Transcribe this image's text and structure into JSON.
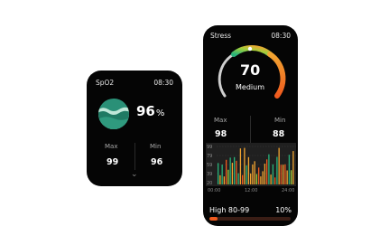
{
  "spo2": {
    "title": "SpO2",
    "time": "08:30",
    "value": "96",
    "unit": "%",
    "max_label": "Max",
    "max_value": "99",
    "min_label": "Min",
    "min_value": "96",
    "chevron": "⌄"
  },
  "stress": {
    "title": "Stress",
    "time": "08:30",
    "value": "70",
    "level": "Medium",
    "max_label": "Max",
    "max_value": "98",
    "min_label": "Min",
    "min_value": "88",
    "gauge_colors": [
      "#cfcfcf",
      "#29b37a",
      "#f2a531",
      "#ef5a1e"
    ],
    "chart": {
      "y_ticks": [
        "99",
        "79",
        "59",
        "39",
        "20"
      ],
      "x_ticks": [
        "00:00",
        "12:00",
        "24:00"
      ]
    },
    "range_label": "High 80-99",
    "range_percent": "10%",
    "range_fraction": 0.1
  }
}
